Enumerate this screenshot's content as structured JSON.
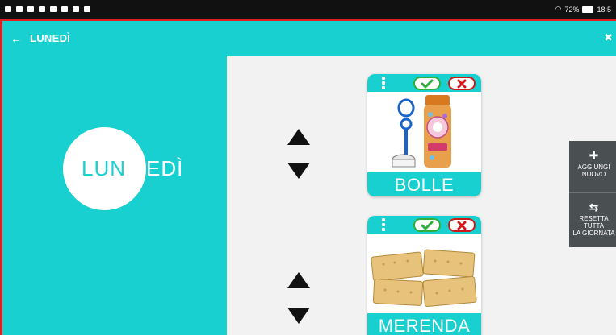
{
  "status": {
    "battery": "72%",
    "time": "18:5"
  },
  "header": {
    "title": "LUNEDÌ"
  },
  "day": {
    "part1": "LUN",
    "part2": "EDÌ"
  },
  "cards": [
    {
      "label": "BOLLE"
    },
    {
      "label": "MERENDA"
    }
  ],
  "sidemenu": {
    "add_line1": "AGGIUNGI",
    "add_line2": "NUOVO",
    "reset_line1": "RESETTA TUTTA",
    "reset_line2": "LA GIORNATA"
  },
  "colors": {
    "accent": "#19d0d0",
    "ok": "#2fae3a",
    "cancel": "#d01a1a",
    "frame": "#e02020"
  }
}
